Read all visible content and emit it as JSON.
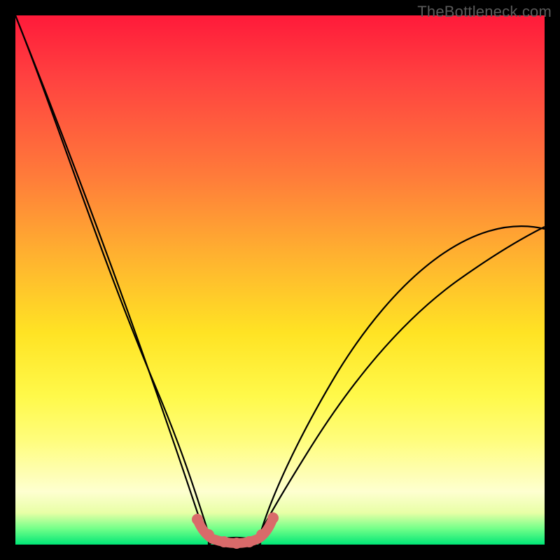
{
  "watermark": "TheBottleneck.com",
  "chart_data": {
    "type": "line",
    "title": "",
    "xlabel": "",
    "ylabel": "",
    "xlim": [
      0,
      100
    ],
    "ylim": [
      0,
      100
    ],
    "series": [
      {
        "name": "curve-left",
        "x": [
          0,
          4,
          8,
          12,
          16,
          20,
          24,
          28,
          32,
          34.5,
          36.5
        ],
        "values": [
          100,
          93,
          84,
          74,
          62,
          49,
          36,
          23,
          11.5,
          5,
          2
        ]
      },
      {
        "name": "curve-right",
        "x": [
          46,
          48.5,
          52,
          58,
          66,
          76,
          88,
          100
        ],
        "values": [
          2,
          5,
          10,
          18,
          28,
          39,
          50,
          60
        ]
      },
      {
        "name": "floor-arc",
        "x": [
          34.5,
          36,
          38,
          40,
          42,
          44,
          46,
          47.5,
          48.5
        ],
        "values": [
          4.3,
          1.8,
          0.8,
          0.6,
          0.6,
          0.8,
          1.8,
          3.2,
          5
        ]
      }
    ],
    "annotations": []
  }
}
